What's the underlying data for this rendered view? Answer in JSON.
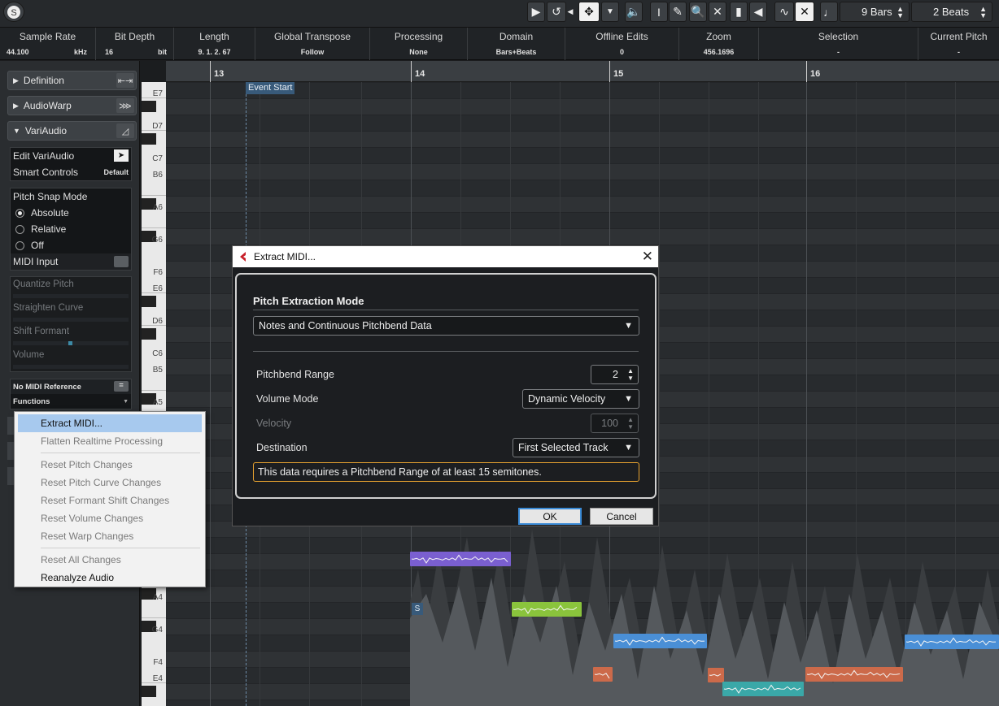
{
  "toolbar": {
    "bars_value": "9 Bars",
    "beats_value": "2 Beats"
  },
  "info_line": [
    {
      "header": "Sample Rate",
      "value": "44.100",
      "unit": "kHz"
    },
    {
      "header": "Bit Depth",
      "value": "16",
      "unit": "bit"
    },
    {
      "header": "Length",
      "value": "9. 1. 2. 67"
    },
    {
      "header": "Global Transpose",
      "value": "Follow"
    },
    {
      "header": "Processing",
      "value": "None"
    },
    {
      "header": "Domain",
      "value": "Bars+Beats"
    },
    {
      "header": "Offline Edits",
      "value": "0"
    },
    {
      "header": "Zoom",
      "value": "456.1696"
    },
    {
      "header": "Selection",
      "value": "-"
    },
    {
      "header": "Current Pitch",
      "value": "-"
    }
  ],
  "inspector": {
    "sections": [
      {
        "label": "Definition",
        "icon": "stretch-icon"
      },
      {
        "label": "AudioWarp",
        "icon": "warp-icon"
      },
      {
        "label": "VariAudio",
        "icon": "pitch-curve-icon"
      }
    ],
    "edit_variaudio": "Edit VariAudio",
    "smart_controls": "Smart Controls",
    "smart_controls_value": "Default",
    "pitch_snap_mode": "Pitch Snap Mode",
    "snap_options": [
      "Absolute",
      "Relative",
      "Off"
    ],
    "snap_selected": "Absolute",
    "midi_input": "MIDI Input",
    "sliders": [
      "Quantize Pitch",
      "Straighten Curve",
      "Shift Formant",
      "Volume"
    ],
    "shift_formant_level": 0.5,
    "midi_reference": "No MIDI Reference",
    "functions": "Functions"
  },
  "ruler": {
    "bars": [
      "13",
      "14",
      "15",
      "16"
    ],
    "event_start": "Event Start"
  },
  "piano_keys": [
    "E7",
    "D7",
    "C7",
    "B6",
    "A6",
    "G6",
    "F6",
    "E6",
    "D6",
    "C6",
    "B5",
    "A5",
    "A4",
    "G4",
    "F4",
    "E4"
  ],
  "segment_label": "S",
  "functions_menu": {
    "items": [
      {
        "label": "Extract MIDI...",
        "enabled": true,
        "highlighted": true
      },
      {
        "label": "Flatten Realtime Processing",
        "enabled": false
      },
      {
        "label": "Reset Pitch Changes",
        "enabled": false
      },
      {
        "label": "Reset Pitch Curve Changes",
        "enabled": false
      },
      {
        "label": "Reset Formant Shift Changes",
        "enabled": false
      },
      {
        "label": "Reset Volume Changes",
        "enabled": false
      },
      {
        "label": "Reset Warp Changes",
        "enabled": false
      },
      {
        "label": "Reset All Changes",
        "enabled": false
      },
      {
        "label": "Reanalyze Audio",
        "enabled": true
      }
    ]
  },
  "dialog": {
    "title": "Extract MIDI...",
    "section_title": "Pitch Extraction Mode",
    "mode_value": "Notes and Continuous Pitchbend Data",
    "pitchbend_range_label": "Pitchbend Range",
    "pitchbend_range_value": "2",
    "volume_mode_label": "Volume Mode",
    "volume_mode_value": "Dynamic Velocity",
    "velocity_label": "Velocity",
    "velocity_value": "100",
    "destination_label": "Destination",
    "destination_value": "First Selected Track",
    "warning": "This data requires a Pitchbend Range of at least 15 semitones.",
    "ok_label": "OK",
    "cancel_label": "Cancel"
  },
  "colors": {
    "accent_warning": "#e8a330",
    "note_purple": "#7a5fd0",
    "note_green": "#8ac43c",
    "note_blue": "#4a8fd6",
    "note_orange": "#cc6a4a",
    "note_teal": "#3aa8a8"
  }
}
